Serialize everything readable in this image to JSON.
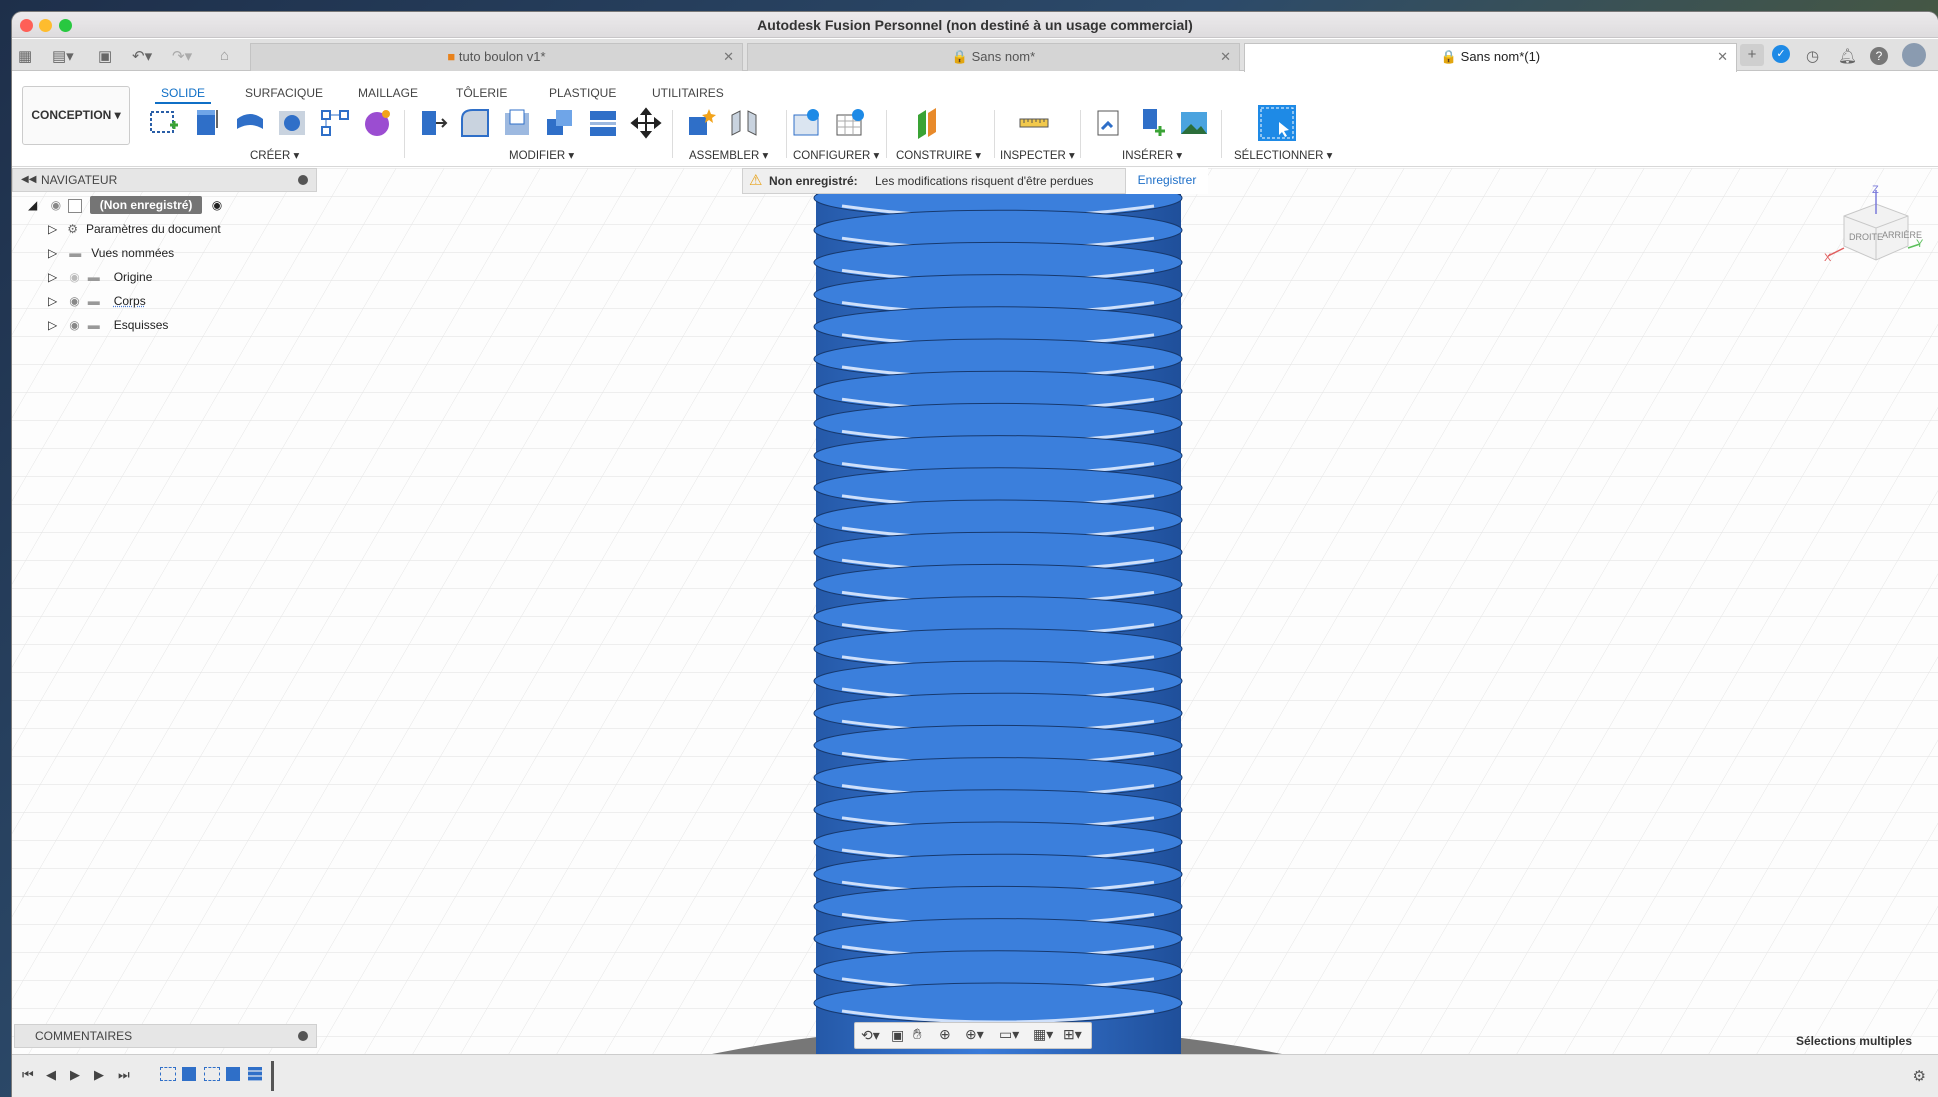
{
  "window": {
    "title": "Autodesk Fusion Personnel (non destiné à un usage commercial)"
  },
  "tabs": [
    {
      "label": "tuto boulon v1*"
    },
    {
      "label": "Sans nom*"
    },
    {
      "label": "Sans nom*(1)"
    }
  ],
  "ribbon": {
    "workspace": "CONCEPTION",
    "tabs": [
      "SOLIDE",
      "SURFACIQUE",
      "MAILLAGE",
      "TÔLERIE",
      "PLASTIQUE",
      "UTILITAIRES"
    ],
    "groups": [
      "CRÉER",
      "MODIFIER",
      "ASSEMBLER",
      "CONFIGURER",
      "CONSTRUIRE",
      "INSPECTER",
      "INSÉRER",
      "SÉLECTIONNER"
    ]
  },
  "navigator": {
    "title": "NAVIGATEUR",
    "root": "(Non enregistré)",
    "items": [
      "Paramètres du document",
      "Vues nommées",
      "Origine",
      "Corps",
      "Esquisses"
    ]
  },
  "warning": {
    "label": "Non enregistré:",
    "message": "Les modifications risquent d'être perdues",
    "action": "Enregistrer"
  },
  "viewcube": {
    "front": "DROITE",
    "back": "ARRIÈRE",
    "axis_x": "X",
    "axis_y": "Y",
    "axis_z": "Z"
  },
  "comments": {
    "title": "COMMENTAIRES"
  },
  "status": {
    "selection": "Sélections multiples"
  },
  "colors": {
    "accent": "#0f6fc6",
    "model": "#2f6fc8"
  }
}
